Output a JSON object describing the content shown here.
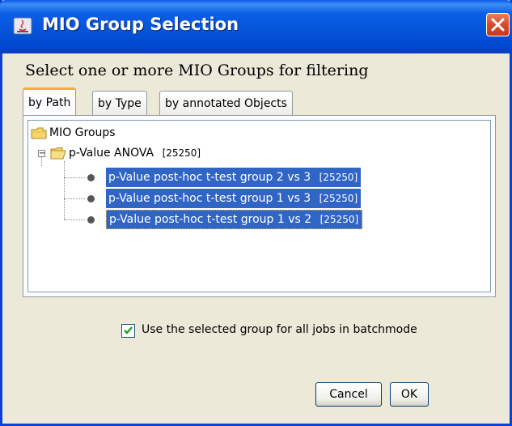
{
  "window": {
    "title": "MIO Group Selection",
    "accent_color": "#0553d8",
    "close_icon": "close-icon"
  },
  "prompt": "Select one or more MIO Groups for filtering",
  "tabs": [
    {
      "label": "by Path",
      "active": true
    },
    {
      "label": "by Type",
      "active": false
    },
    {
      "label": "by annotated Objects",
      "active": false
    }
  ],
  "tree": {
    "root": {
      "label": "MIO Groups",
      "icon": "folder-icon"
    },
    "group": {
      "label": "p-Value ANOVA",
      "count": "[25250]",
      "icon": "folder-icon",
      "expanded": true
    },
    "children": [
      {
        "label": "p-Value post-hoc t-test group 2 vs 3",
        "count": "[25250]",
        "selected": true
      },
      {
        "label": "p-Value post-hoc t-test group 1 vs 3",
        "count": "[25250]",
        "selected": true
      },
      {
        "label": "p-Value post-hoc t-test group 1 vs 2",
        "count": "[25250]",
        "selected": true,
        "focused": true
      }
    ],
    "selection_color": "#3165c5"
  },
  "batch_option": {
    "label": "Use the selected group for all jobs in batchmode",
    "checked": true
  },
  "buttons": {
    "cancel": "Cancel",
    "ok": "OK"
  }
}
